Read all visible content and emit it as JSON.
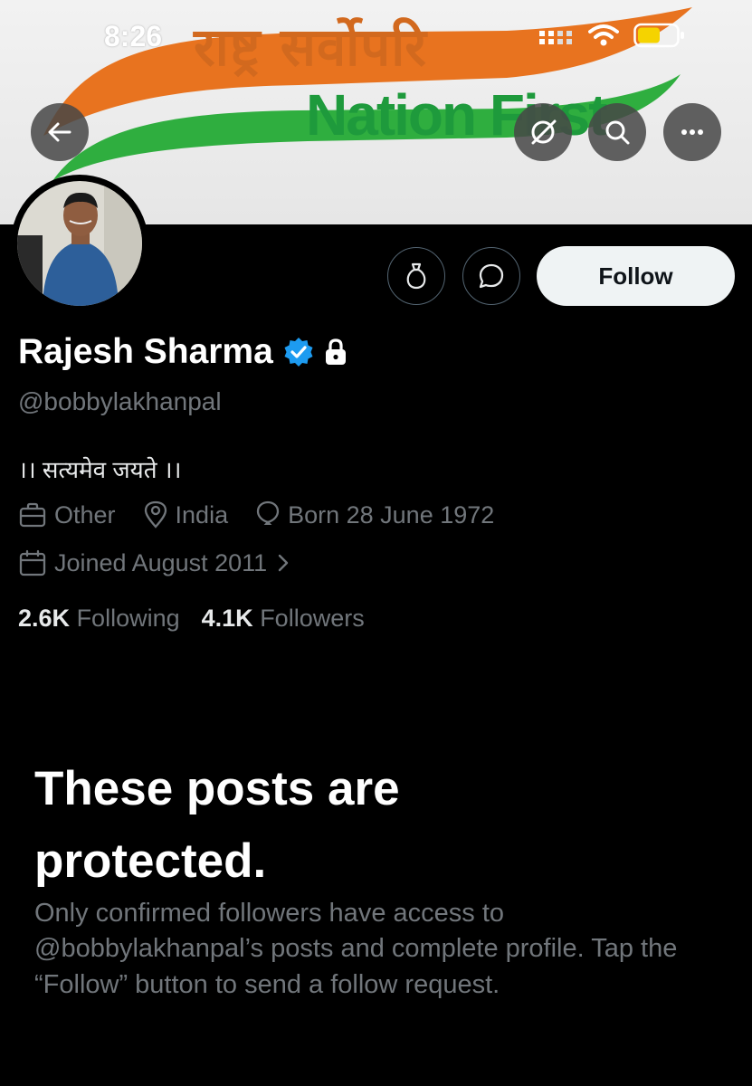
{
  "status_bar": {
    "time": "8:26"
  },
  "banner": {
    "hindi_text": "राष्ट्र सर्वोपरि",
    "english_text": "Nation First"
  },
  "header_buttons": {
    "back": "back-arrow-icon",
    "extra": "grok-icon",
    "search": "search-icon",
    "more": "more-icon"
  },
  "profile": {
    "name": "Rajesh Sharma",
    "handle": "@bobbylakhanpal",
    "bio": "।। सत्यमेव जयते ।।",
    "category": "Other",
    "location": "India",
    "born": "Born 28 June 1972",
    "joined": "Joined August 2011",
    "following_count": "2.6K",
    "following_label": "Following",
    "followers_count": "4.1K",
    "followers_label": "Followers"
  },
  "actions": {
    "follow_label": "Follow"
  },
  "protected": {
    "title": "These posts are protected.",
    "body": "Only confirmed followers have access to @bobbylakhanpal’s posts and complete profile. Tap the “Follow” button to send a follow request."
  },
  "colors": {
    "background": "#000000",
    "verified": "#1d9bf0",
    "muted": "#71767b",
    "saffron": "#e8731f",
    "green": "#2fae3f"
  }
}
